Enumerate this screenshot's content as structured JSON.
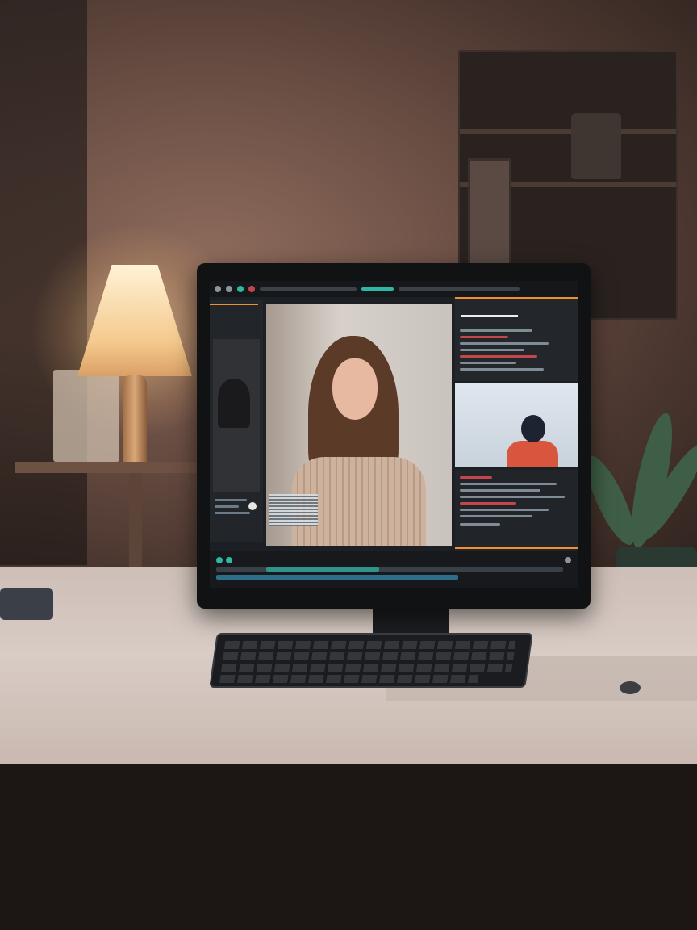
{
  "scene": {
    "type": "desk setup photo",
    "screen": {
      "app_title": "",
      "panels": [
        "left-browser",
        "viewer",
        "inspector",
        "preview",
        "notes"
      ],
      "accent_color": "#f0902c",
      "highlight_color": "#2fb7a4",
      "alert_color": "#c2464a"
    }
  },
  "icons": {
    "toolbar": [
      "play-icon",
      "cut-icon",
      "settings-icon",
      "export-icon"
    ],
    "timeline": [
      "marker-icon",
      "zoom-icon"
    ]
  }
}
